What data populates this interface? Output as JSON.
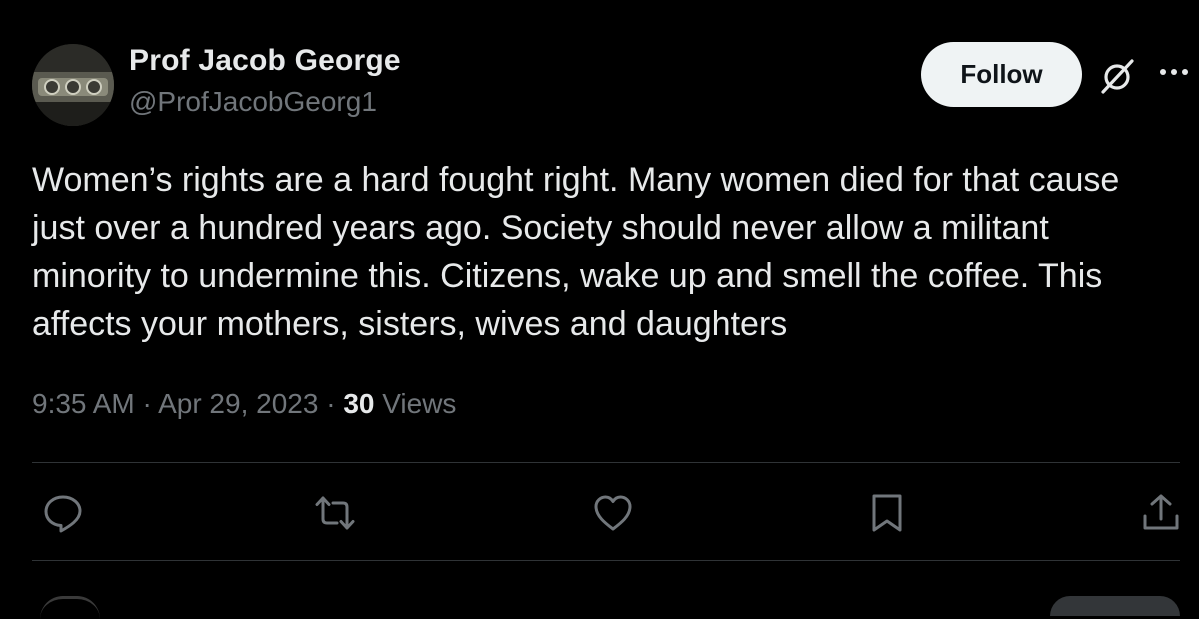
{
  "author": {
    "name": "Prof Jacob George",
    "handle": "@ProfJacobGeorg1"
  },
  "header": {
    "follow_label": "Follow"
  },
  "tweet": {
    "text": "Women’s rights are a hard fought right. Many women died for that cause\njust over a hundred years ago. Society should never allow a militant\nminority to undermine this. Citizens, wake up and smell the coffee. This\naffects your mothers, sisters, wives and daughters",
    "time": "9:35 AM",
    "date": "Apr 29, 2023",
    "separator": " · ",
    "views_count": "30",
    "views_label": "Views"
  },
  "icons": {
    "grok": "grok-icon",
    "more": "more-icon",
    "reply": "reply-icon",
    "retweet": "retweet-icon",
    "like": "heart-icon",
    "bookmark": "bookmark-icon",
    "share": "share-icon"
  },
  "colors": {
    "background": "#000000",
    "text_primary": "#e7e9ea",
    "text_secondary": "#71767b",
    "follow_bg": "#eff3f4",
    "divider": "#2f3336"
  }
}
